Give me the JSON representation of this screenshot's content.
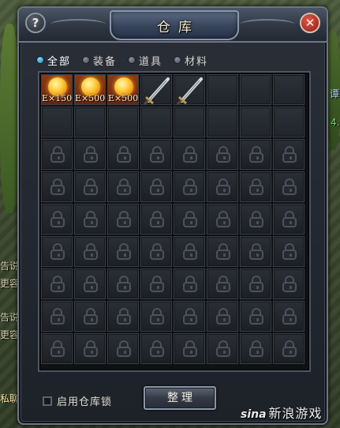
{
  "window": {
    "title": "仓库",
    "help_label": "?",
    "close_label": "✕"
  },
  "tabs": [
    {
      "label": "全部",
      "active": true
    },
    {
      "label": "装备",
      "active": false
    },
    {
      "label": "道具",
      "active": false
    },
    {
      "label": "材料",
      "active": false
    }
  ],
  "grid": {
    "columns": 8,
    "rows": 9,
    "items": [
      {
        "icon": "exp-orb-icon",
        "label": "E×150"
      },
      {
        "icon": "exp-orb-icon",
        "label": "E×500"
      },
      {
        "icon": "exp-orb-icon",
        "label": "E×500"
      },
      {
        "icon": "sword-icon",
        "label": ""
      },
      {
        "icon": "sword-icon",
        "label": ""
      }
    ],
    "unlocked_slots": 16
  },
  "footer": {
    "lock_label": "启用仓库锁",
    "lock_checked": false,
    "sort_label": "整理"
  },
  "watermark": {
    "brand": "sina",
    "text": "新浪游戏"
  },
  "background": {
    "chat_fragments": [
      "谭",
      "4.",
      "告说",
      "更容",
      "告说",
      "更容",
      "私聊"
    ]
  },
  "colors": {
    "window_bg": "#1d2128",
    "frame": "#6c7583",
    "active_tab_dot": "#3aa9e6",
    "close_button": "#c0342a",
    "exp_item_bg": "#7a2e12"
  }
}
